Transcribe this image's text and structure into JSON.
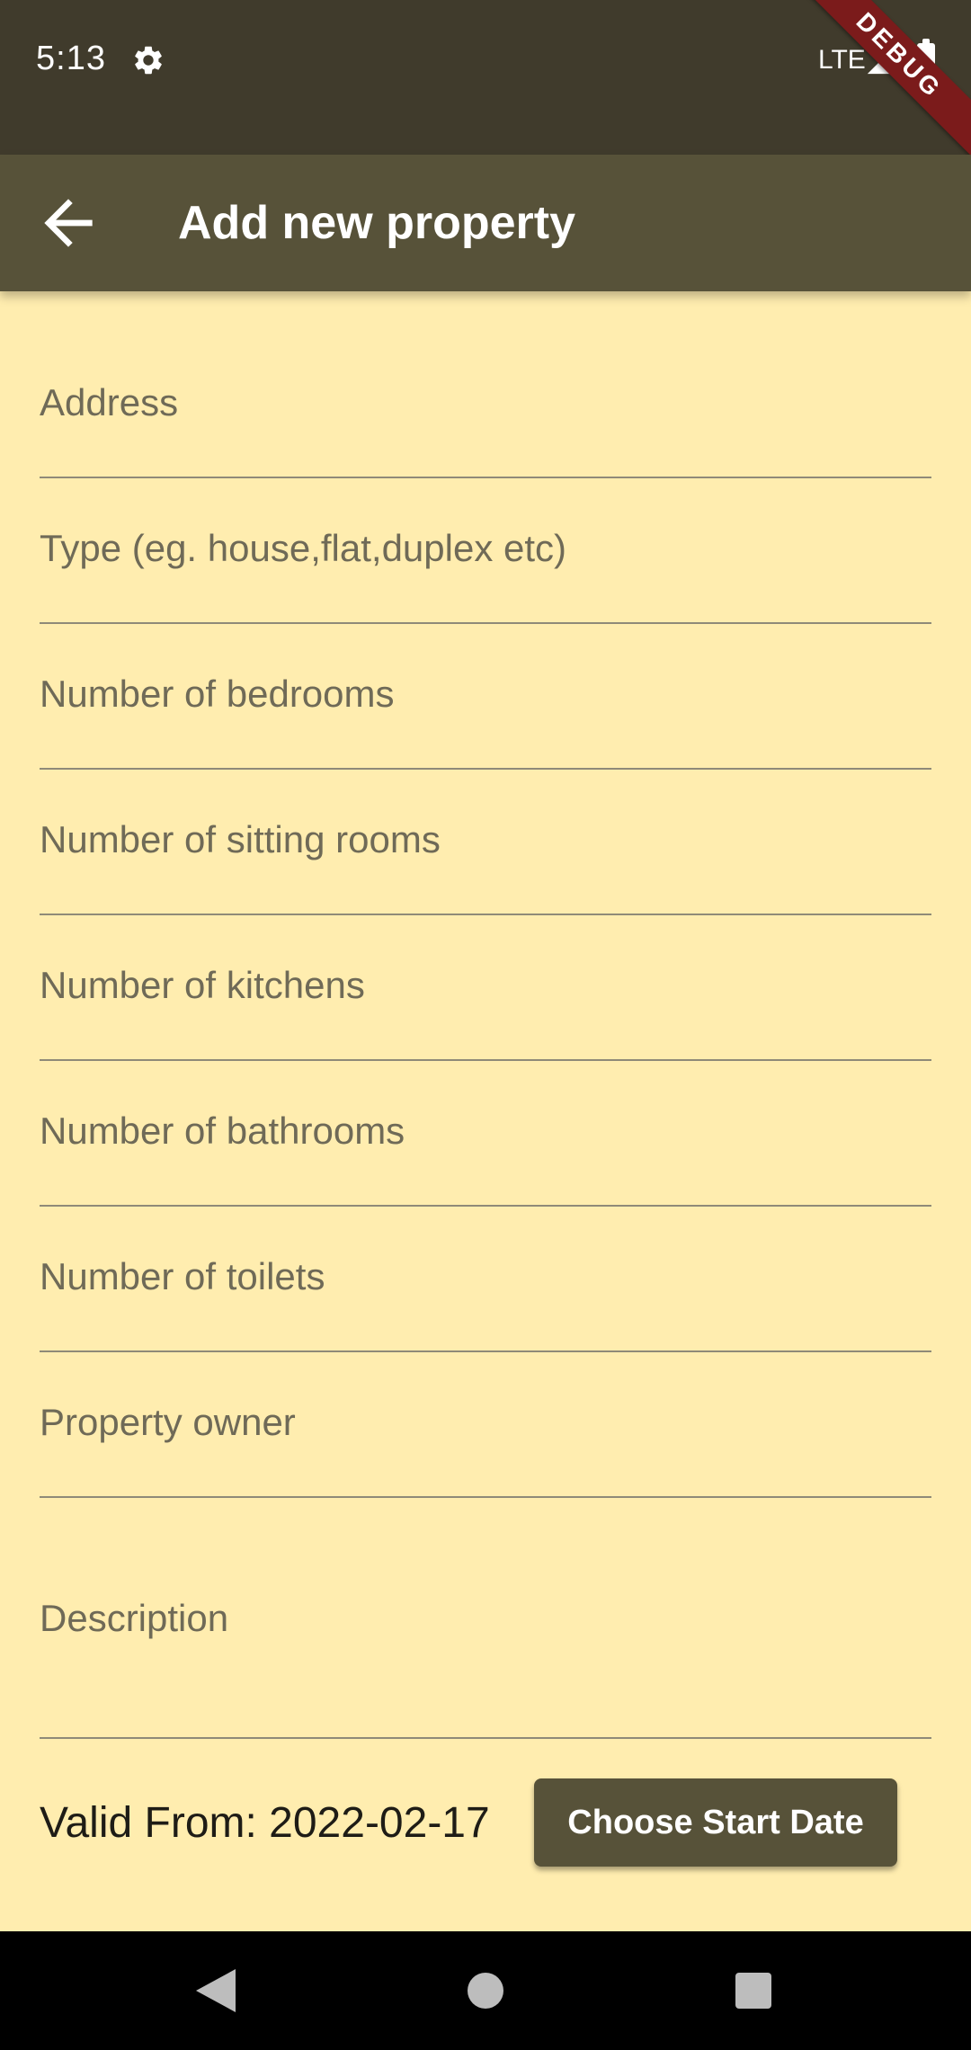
{
  "status_bar": {
    "time": "5:13",
    "network": "LTE",
    "icons": [
      "gear-icon",
      "signal-icon",
      "battery-icon"
    ]
  },
  "debug_banner": "DEBUG",
  "app_bar": {
    "title": "Add new property",
    "back_icon": "arrow-back-icon"
  },
  "form": {
    "address": {
      "placeholder": "Address"
    },
    "type": {
      "placeholder": "Type (eg. house,flat,duplex etc)"
    },
    "bedrooms": {
      "placeholder": "Number of bedrooms"
    },
    "sitting_rooms": {
      "placeholder": "Number of sitting rooms"
    },
    "kitchens": {
      "placeholder": "Number of kitchens"
    },
    "bathrooms": {
      "placeholder": "Number of bathrooms"
    },
    "toilets": {
      "placeholder": "Number of toilets"
    },
    "owner": {
      "placeholder": "Property owner"
    },
    "description": {
      "placeholder": "Description"
    }
  },
  "valid_from": "Valid From: 2022-02-17",
  "choose_date_label": "Choose Start Date",
  "colors": {
    "background": "#FFEDAF",
    "status_bar": "#403B2C",
    "app_bar": "#575239",
    "button": "#575239",
    "debug_ribbon": "#7B1B1B"
  }
}
